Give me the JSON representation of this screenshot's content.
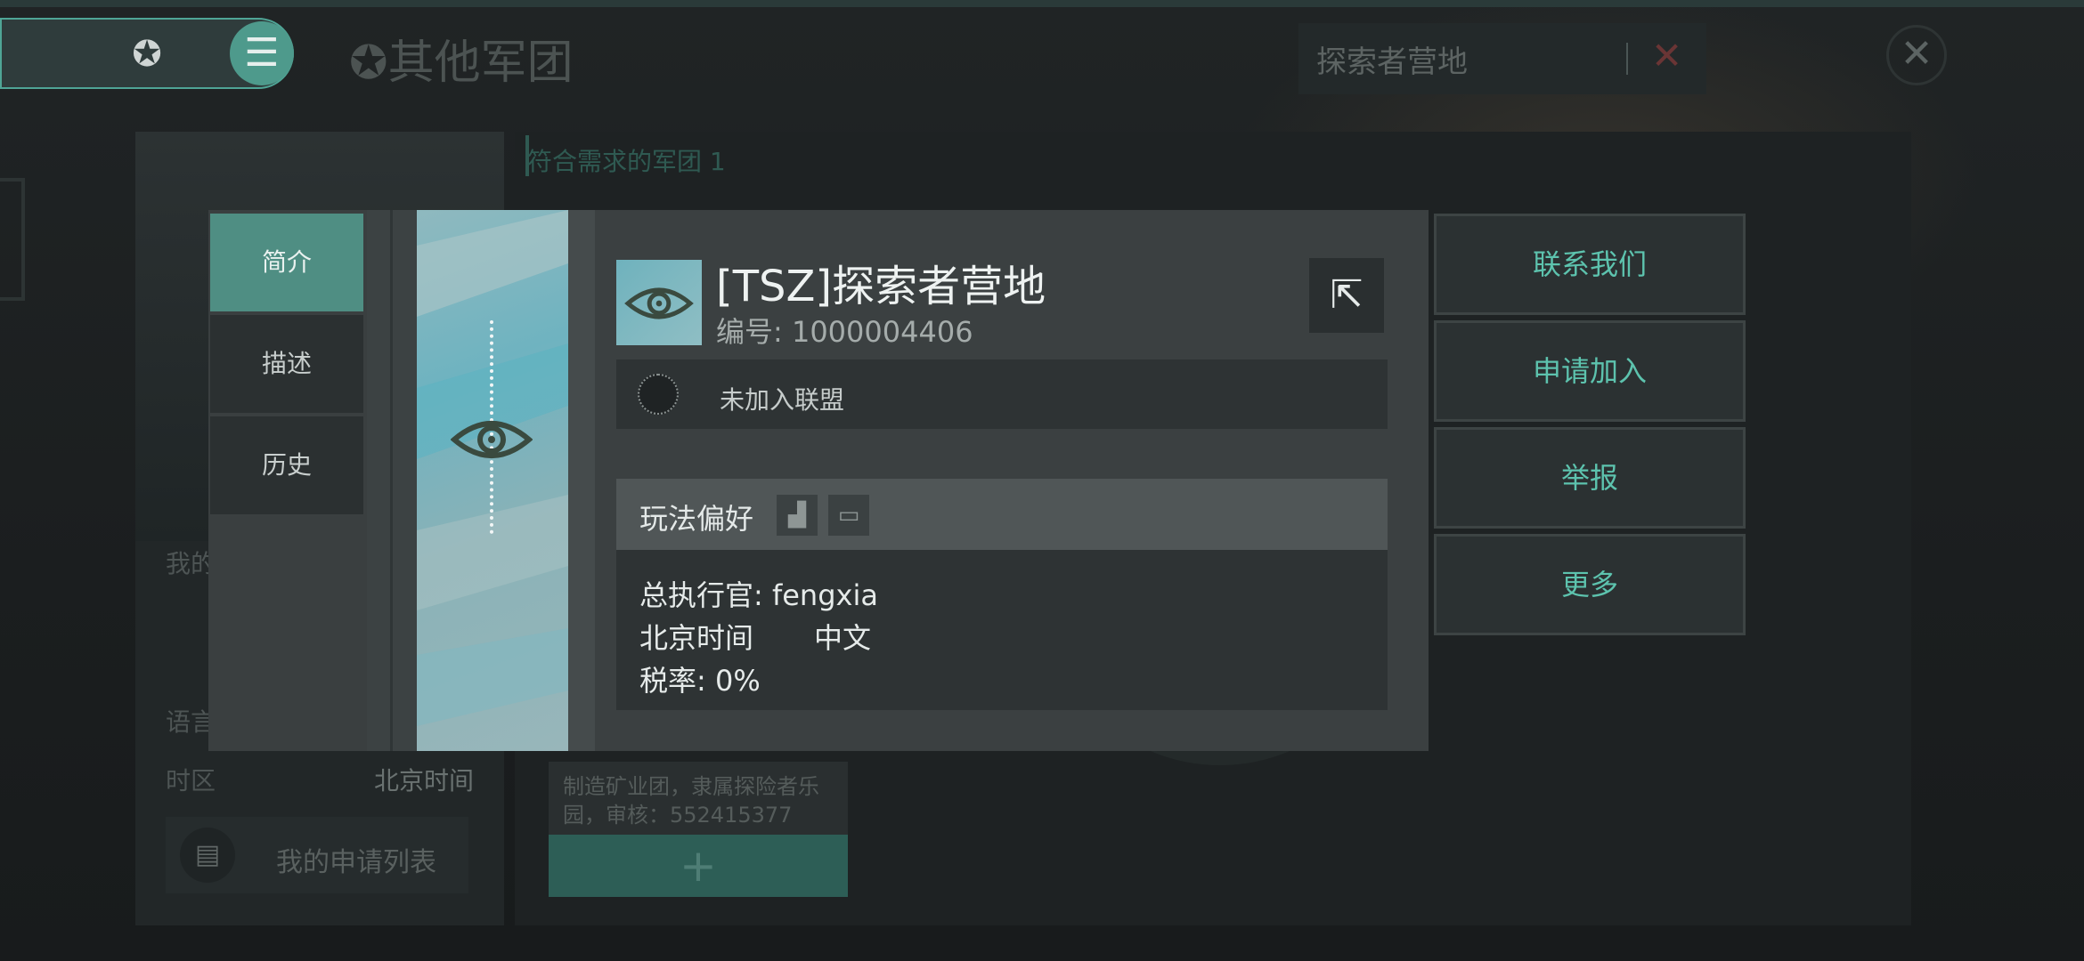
{
  "header": {
    "title": "其他军团",
    "search_value": "探索者营地"
  },
  "list": {
    "matching_label": "符合需求的军团 1",
    "card_desc": "制造矿业团，隶属探险者乐园，审核：552415377"
  },
  "left_panel": {
    "my_label": "我的",
    "language_label": "语言",
    "timezone_label": "时区",
    "timezone_value": "北京时间",
    "apply_list": "我的申请列表"
  },
  "modal": {
    "tabs": [
      {
        "label": "简介",
        "active": true
      },
      {
        "label": "描述"
      },
      {
        "label": "历史"
      }
    ],
    "corp_name": "[TSZ]探索者营地",
    "corp_id": "编号: 1000004406",
    "alliance": "未加入联盟",
    "preference_title": "玩法偏好",
    "ceo": "总执行官: fengxia",
    "timezone": "北京时间",
    "language": "中文",
    "tax": "税率: 0%"
  },
  "actions": {
    "contact": "联系我们",
    "apply": "申请加入",
    "report": "举报",
    "more": "更多"
  },
  "colors": {
    "accent": "#4f8e83",
    "action_text": "#5dc3ae",
    "art": "#6fb3c0"
  },
  "icons": [
    "star-emblem-icon",
    "menu-icon",
    "close-icon",
    "share-icon",
    "eye-logo-icon",
    "alliance-icon",
    "factory-icon",
    "chat-icon",
    "document-icon",
    "plus-icon"
  ]
}
